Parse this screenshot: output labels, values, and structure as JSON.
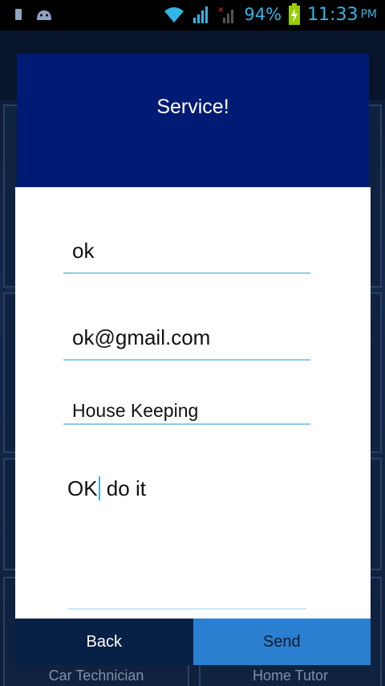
{
  "status_bar": {
    "battery_pct": "94%",
    "time": "11:33",
    "ampm": "PM"
  },
  "background": {
    "tiles": [
      {
        "label": "Car Technician"
      },
      {
        "label": "Home Tutor"
      }
    ]
  },
  "dialog": {
    "title": "Service!",
    "name_value": "ok",
    "email_value": "ok@gmail.com",
    "service_value": "House Keeping",
    "message_before_cursor": "OK",
    "message_after_cursor": " do it",
    "back_label": "Back",
    "send_label": "Send"
  },
  "colors": {
    "title_bar": "#001b73",
    "accent": "#33b5e5",
    "send_button": "#2a7fd0",
    "back_button": "#072045"
  }
}
